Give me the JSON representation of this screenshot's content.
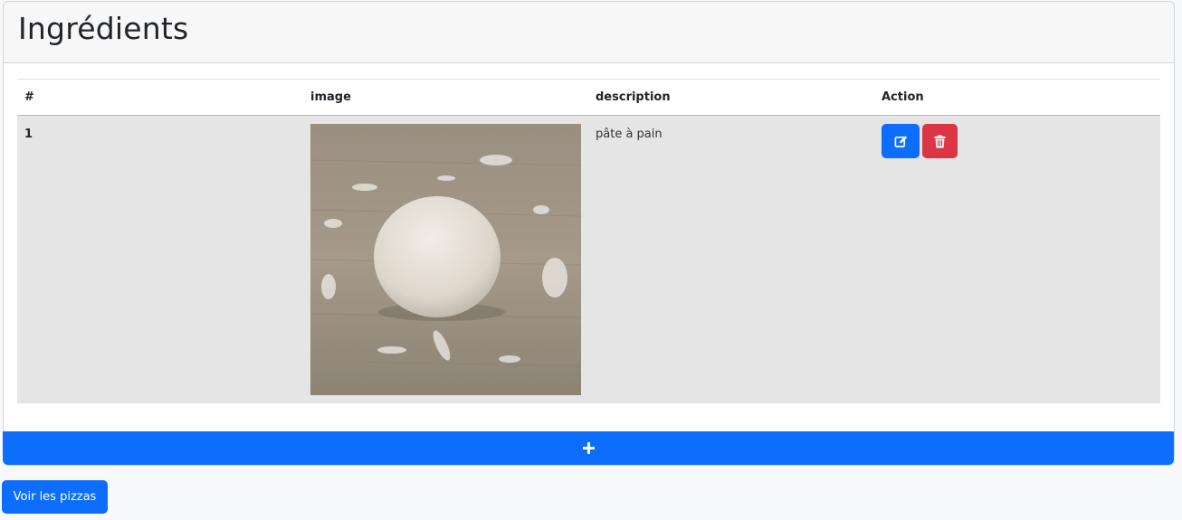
{
  "card": {
    "title": "Ingrédients"
  },
  "table": {
    "headers": [
      "#",
      "image",
      "description",
      "Action"
    ],
    "rows": [
      {
        "index": "1",
        "image_subject": "ball of bread dough on floured wooden surface",
        "description": "pâte à pain",
        "edit_icon": "edit-icon",
        "delete_icon": "trash-icon"
      }
    ]
  },
  "add_button": {
    "label": "+"
  },
  "footer": {
    "pizzas_button_label": "Voir les pizzas"
  },
  "colors": {
    "primary": "#0d6efd",
    "danger": "#dc3545",
    "row_bg": "#e5e5e5",
    "header_bg": "#f7f7f7"
  }
}
